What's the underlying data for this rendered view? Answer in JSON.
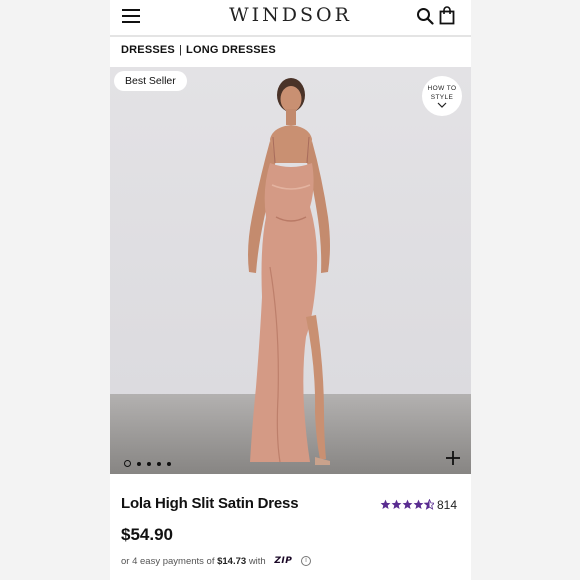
{
  "header": {
    "logo": "WINDSOR"
  },
  "breadcrumb": {
    "category": "DRESSES",
    "separator": "|",
    "subcategory": "LONG DRESSES"
  },
  "image": {
    "badge": "Best Seller",
    "how_to_style_line1": "HOW TO",
    "how_to_style_line2": "STYLE",
    "carousel_total": 5,
    "carousel_active": 1
  },
  "product": {
    "title": "Lola High Slit Satin Dress",
    "rating": 4.5,
    "rating_count": "814",
    "price": "$54.90",
    "installment_prefix": "or 4 easy payments of",
    "installment_amount": "$14.73",
    "installment_suffix": "with",
    "payment_provider": "ZIP"
  },
  "colors": {
    "star_color": "#5a2d91",
    "dress_color": "#d49a85"
  }
}
